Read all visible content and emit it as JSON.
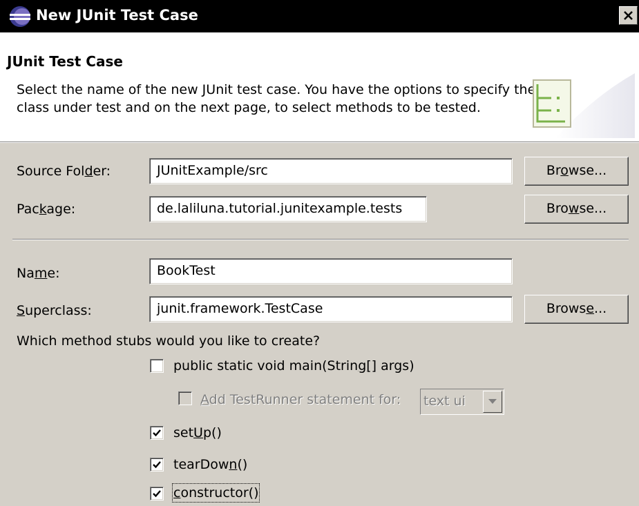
{
  "window": {
    "title": "New JUnit Test Case",
    "icon": "eclipse-icon"
  },
  "banner": {
    "title": "JUnit Test Case",
    "description": "Select the name of the new JUnit test case. You have the options to specify the class under test and on the next page, to select methods to be tested.",
    "icon": "junit-wizard-icon"
  },
  "form": {
    "source_folder": {
      "label_pre": "Source Fol",
      "label_mn": "d",
      "label_post": "er:",
      "value": "JUnitExample/src"
    },
    "package": {
      "label_pre": "Pac",
      "label_mn": "k",
      "label_post": "age:",
      "value": "de.laliluna.tutorial.junitexample.tests"
    },
    "name": {
      "label_pre": "Na",
      "label_mn": "m",
      "label_post": "e:",
      "value": "BookTest"
    },
    "superclass": {
      "label_pre": "",
      "label_mn": "S",
      "label_post": "uperclass:",
      "value": "junit.framework.TestCase"
    },
    "browse_source": {
      "pre": "Br",
      "mn": "o",
      "post": "wse..."
    },
    "browse_package": {
      "pre": "Bro",
      "mn": "w",
      "post": "se..."
    },
    "browse_superclass": {
      "pre": "Brows",
      "mn": "e",
      "post": "..."
    }
  },
  "stubs": {
    "question": "Which method stubs would you like to create?",
    "main": {
      "pre": "public static void main(Strin",
      "mn": "g",
      "post": "[] args)",
      "checked": false
    },
    "testrunner": {
      "pre": "",
      "mn": "A",
      "post": "dd TestRunner statement for:",
      "checked": false,
      "enabled": false
    },
    "testrunner_combo": "text ui",
    "setup": {
      "pre": "set",
      "mn": "U",
      "post": "p()",
      "checked": true
    },
    "teardown": {
      "pre": "tearDow",
      "mn": "n",
      "post": "()",
      "checked": true
    },
    "constructor": {
      "pre": "",
      "mn": "c",
      "post": "onstructor()",
      "checked": true
    }
  },
  "colors": {
    "dialog_bg": "#d4d0c8",
    "titlebar_bg": "#000000",
    "banner_bg": "#ffffff",
    "disabled_text": "#808080"
  }
}
